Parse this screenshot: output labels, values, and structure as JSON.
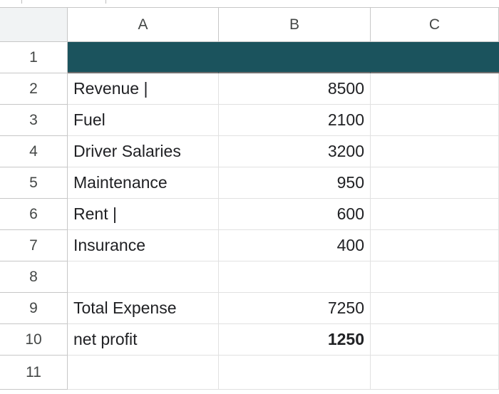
{
  "colors": {
    "header_band": "#1b535d",
    "gridline": "#e1e1e1",
    "header_text": "#444746",
    "cell_text": "#202124"
  },
  "columns": [
    "A",
    "B",
    "C"
  ],
  "rows": [
    {
      "num": "1",
      "a": "",
      "b": ""
    },
    {
      "num": "2",
      "a": "Revenue |",
      "b": "8500"
    },
    {
      "num": "3",
      "a": "Fuel",
      "b": "2100"
    },
    {
      "num": "4",
      "a": "Driver Salaries",
      "b": "3200"
    },
    {
      "num": "5",
      "a": "Maintenance",
      "b": "950"
    },
    {
      "num": "6",
      "a": "Rent |",
      "b": "600"
    },
    {
      "num": "7",
      "a": "Insurance",
      "b": "400"
    },
    {
      "num": "8",
      "a": "",
      "b": ""
    },
    {
      "num": "9",
      "a": "Total Expense",
      "b": "7250"
    },
    {
      "num": "10",
      "a": "net profit",
      "b": "1250"
    },
    {
      "num": "11",
      "a": "",
      "b": ""
    }
  ]
}
